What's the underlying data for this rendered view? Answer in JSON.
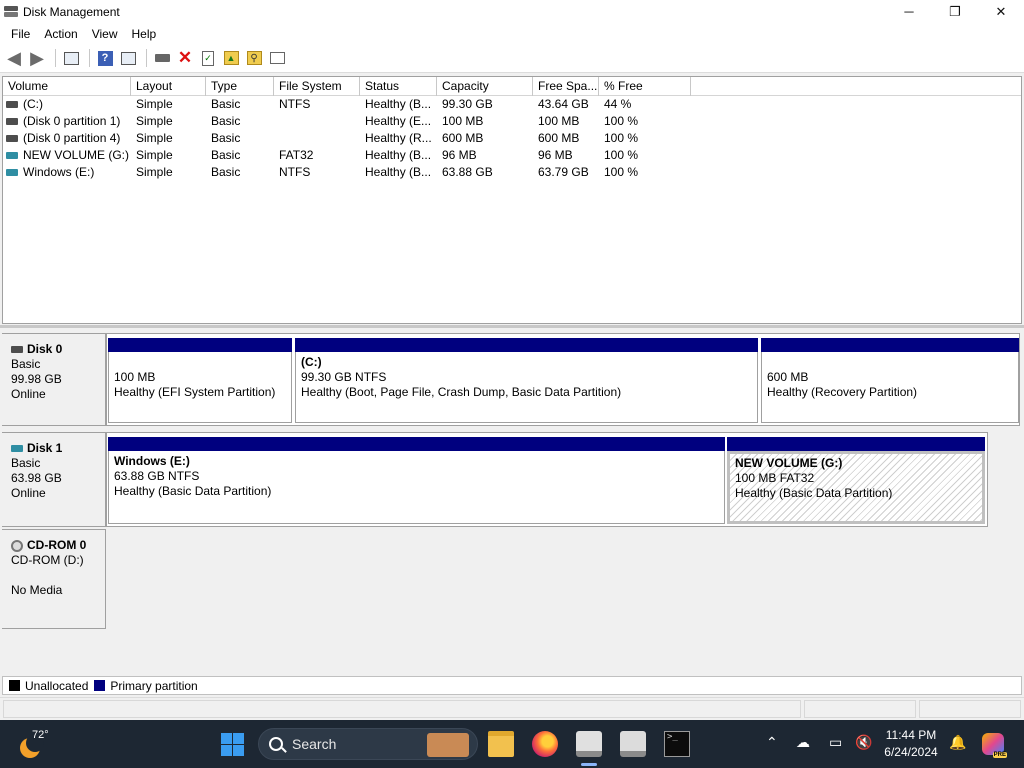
{
  "window": {
    "title": "Disk Management",
    "minimize": "─",
    "maximize": "❐",
    "close": "✕"
  },
  "menu": {
    "items": [
      "File",
      "Action",
      "View",
      "Help"
    ]
  },
  "toolbar": {
    "back_icon": "back-arrow-icon",
    "forward_icon": "forward-arrow-icon",
    "delete_symbol": "✕",
    "help_symbol": "?"
  },
  "volumes": {
    "headers": [
      "Volume",
      "Layout",
      "Type",
      "File System",
      "Status",
      "Capacity",
      "Free Spa...",
      "% Free"
    ],
    "rows": [
      {
        "volume": "(C:)",
        "layout": "Simple",
        "type": "Basic",
        "fs": "NTFS",
        "status": "Healthy (B...",
        "capacity": "99.30 GB",
        "free": "43.64 GB",
        "pct": "44 %",
        "icon": "gray"
      },
      {
        "volume": "(Disk 0 partition 1)",
        "layout": "Simple",
        "type": "Basic",
        "fs": "",
        "status": "Healthy (E...",
        "capacity": "100 MB",
        "free": "100 MB",
        "pct": "100 %",
        "icon": "gray"
      },
      {
        "volume": "(Disk 0 partition 4)",
        "layout": "Simple",
        "type": "Basic",
        "fs": "",
        "status": "Healthy (R...",
        "capacity": "600 MB",
        "free": "600 MB",
        "pct": "100 %",
        "icon": "gray"
      },
      {
        "volume": "NEW VOLUME (G:)",
        "layout": "Simple",
        "type": "Basic",
        "fs": "FAT32",
        "status": "Healthy (B...",
        "capacity": "96 MB",
        "free": "96 MB",
        "pct": "100 %",
        "icon": "teal"
      },
      {
        "volume": "Windows (E:)",
        "layout": "Simple",
        "type": "Basic",
        "fs": "NTFS",
        "status": "Healthy (B...",
        "capacity": "63.88 GB",
        "free": "63.79 GB",
        "pct": "100 %",
        "icon": "teal"
      }
    ]
  },
  "disks": {
    "disk0": {
      "name": "Disk 0",
      "type": "Basic",
      "size": "99.98 GB",
      "state": "Online",
      "p1": {
        "line1": "100 MB",
        "line2": "Healthy (EFI System Partition)"
      },
      "p2": {
        "name": "(C:)",
        "line1": "99.30 GB NTFS",
        "line2": "Healthy (Boot, Page File, Crash Dump, Basic Data Partition)"
      },
      "p3": {
        "line1": "600 MB",
        "line2": "Healthy (Recovery Partition)"
      }
    },
    "disk1": {
      "name": "Disk 1",
      "type": "Basic",
      "size": "63.98 GB",
      "state": "Online",
      "p1": {
        "name": "Windows  (E:)",
        "line1": "63.88 GB NTFS",
        "line2": "Healthy (Basic Data Partition)"
      },
      "p2": {
        "name": "NEW VOLUME  (G:)",
        "line1": "100 MB FAT32",
        "line2": "Healthy (Basic Data Partition)"
      }
    },
    "cdrom0": {
      "name": "CD-ROM 0",
      "drive": "CD-ROM (D:)",
      "media": "No Media"
    }
  },
  "legend": {
    "unallocated": {
      "label": "Unallocated",
      "color": "#000000"
    },
    "primary": {
      "label": "Primary partition",
      "color": "#00007f"
    }
  },
  "taskbar": {
    "weather_temp": "72°",
    "search_label": "Search",
    "time": "11:44 PM",
    "date": "6/24/2024",
    "copilot_badge": "PRE"
  }
}
